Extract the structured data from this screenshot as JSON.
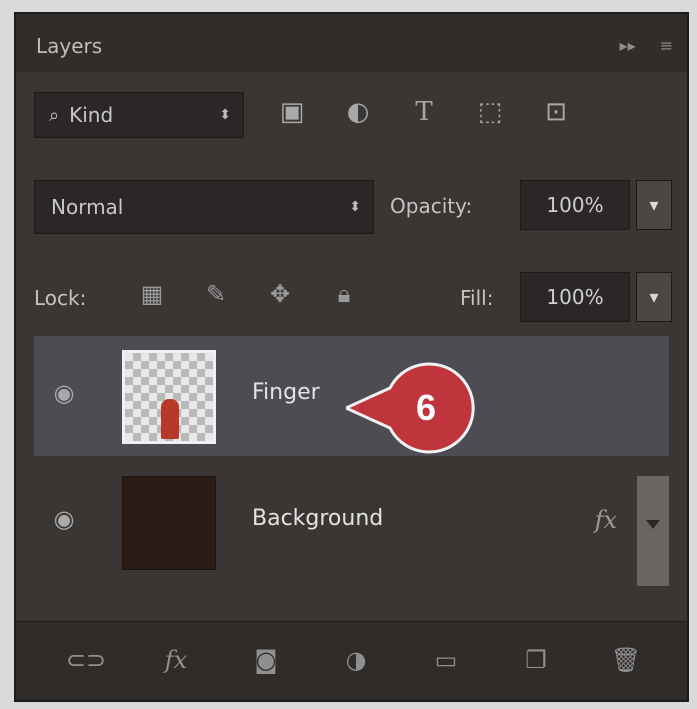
{
  "panel": {
    "title": "Layers"
  },
  "filter": {
    "kind_label": "Kind",
    "icons": [
      "image-filter-icon",
      "adjustment-filter-icon",
      "type-filter-icon",
      "shape-filter-icon",
      "smart-object-filter-icon"
    ]
  },
  "blend": {
    "mode": "Normal",
    "opacity_label": "Opacity:",
    "opacity_value": "100%"
  },
  "lock": {
    "label": "Lock:",
    "fill_label": "Fill:",
    "fill_value": "100%"
  },
  "layers": [
    {
      "name": "Finger",
      "selected": true
    },
    {
      "name": "Background",
      "fx": "fx"
    }
  ],
  "callout": {
    "number": "6",
    "color": "#c0343b"
  },
  "footer": {
    "icons": [
      "link-icon",
      "fx-icon",
      "mask-icon",
      "adjustment-icon",
      "folder-icon",
      "new-layer-icon",
      "trash-icon"
    ],
    "fx_label": "fx"
  }
}
